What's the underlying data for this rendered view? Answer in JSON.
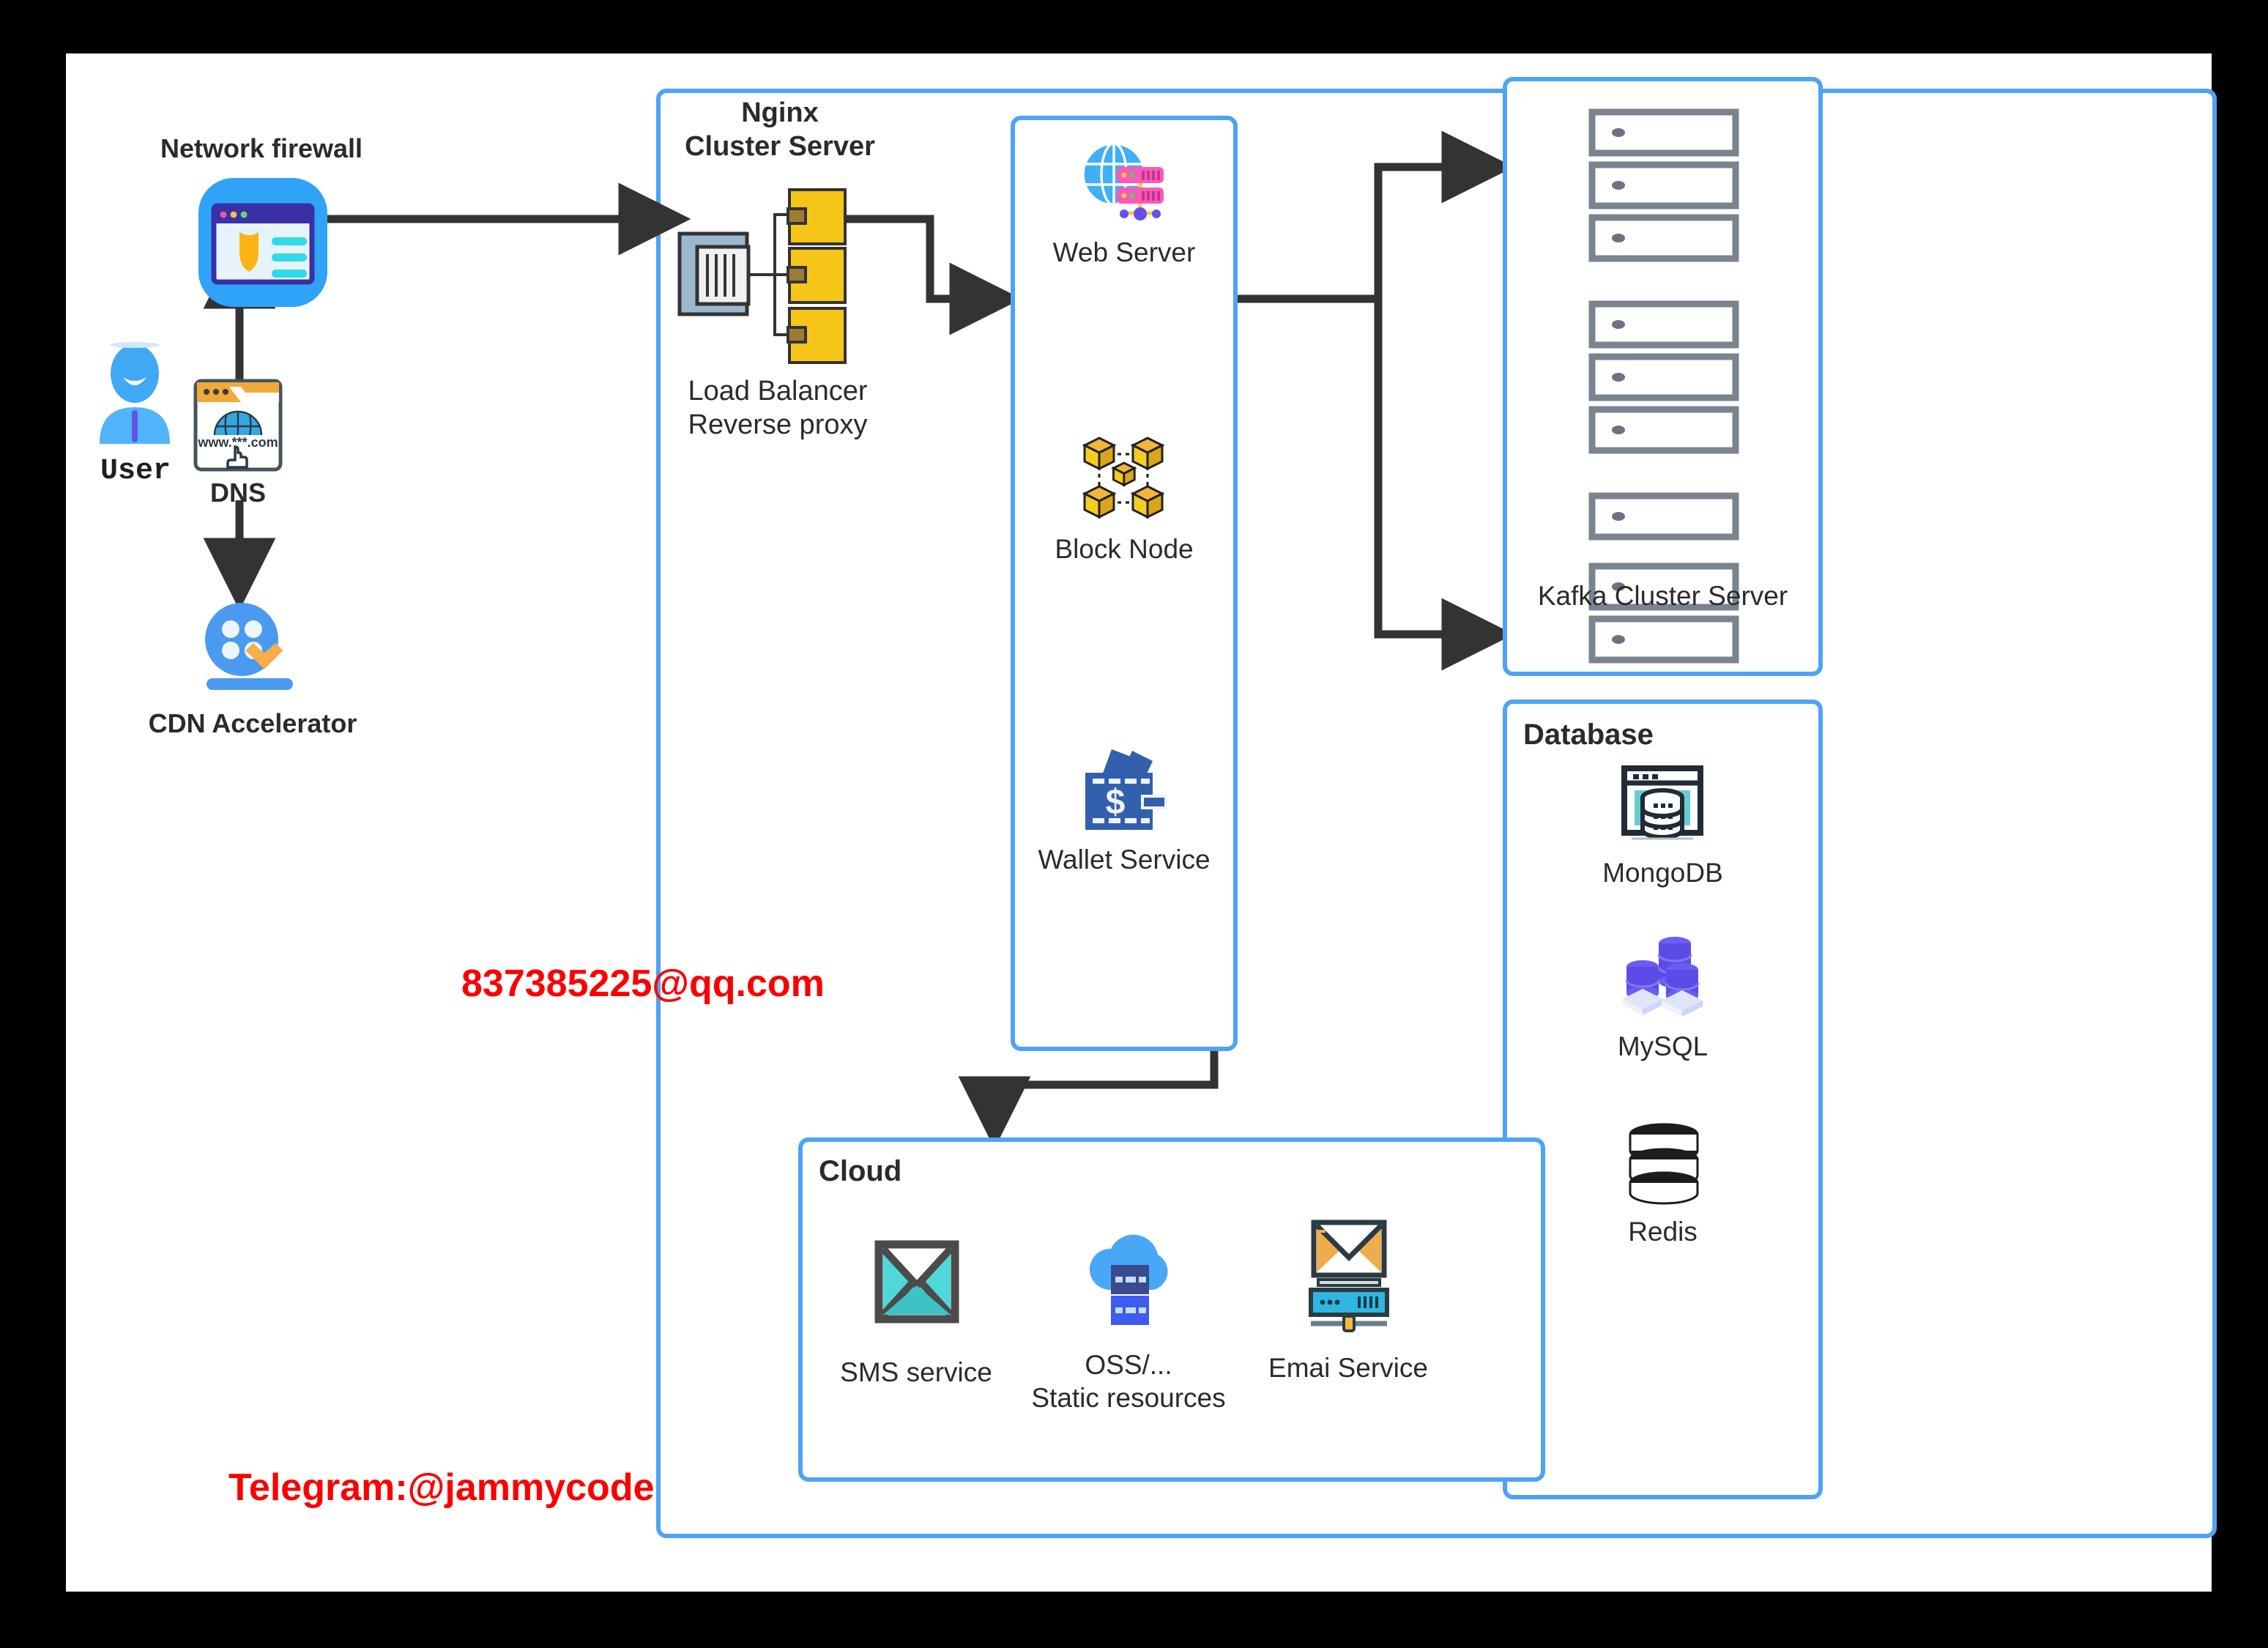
{
  "diagram": {
    "title": "System Architecture Diagram",
    "accent_blue": "#4da3f5",
    "arrow_color": "#333333",
    "watermark_color": "#fb0000"
  },
  "nodes": {
    "user": {
      "label": "User",
      "icon": "user-avatar-icon"
    },
    "dns": {
      "label": "DNS",
      "icon": "dns-browser-icon",
      "url_text": "www.***.com"
    },
    "firewall": {
      "label": "Network firewall",
      "icon": "firewall-shield-icon"
    },
    "cdn": {
      "label": "CDN Accelerator",
      "icon": "cdn-accelerator-icon"
    },
    "nginx": {
      "title": "Nginx\nCluster Server",
      "caption": "Load Balancer\nReverse proxy",
      "icon": "load-balancer-icon"
    }
  },
  "services_box": {
    "items": [
      {
        "label": "Web Server",
        "icon": "web-server-globe-icon"
      },
      {
        "label": "Block Node",
        "icon": "block-node-cubes-icon"
      },
      {
        "label": "Wallet Service",
        "icon": "wallet-dollar-icon"
      }
    ]
  },
  "kafka_box": {
    "label": "Kafka Cluster Server",
    "icon": "server-rack-icon",
    "groups": 3,
    "slots_per_group": 3
  },
  "database_box": {
    "title": "Database",
    "items": [
      {
        "label": "MongoDB",
        "icon": "mongodb-window-icon"
      },
      {
        "label": "MySQL",
        "icon": "mysql-cylinders-icon"
      },
      {
        "label": "Redis",
        "icon": "redis-cylinder-icon"
      }
    ]
  },
  "cloud_box": {
    "title": "Cloud",
    "items": [
      {
        "label": "SMS service",
        "icon": "sms-envelope-icon"
      },
      {
        "label": "OSS/...\nStatic resources",
        "icon": "oss-cloud-storage-icon"
      },
      {
        "label": "Emai Service",
        "icon": "email-server-icon"
      }
    ]
  },
  "watermarks": {
    "email": "837385225@qq.com",
    "telegram": "Telegram:@jammycode"
  }
}
